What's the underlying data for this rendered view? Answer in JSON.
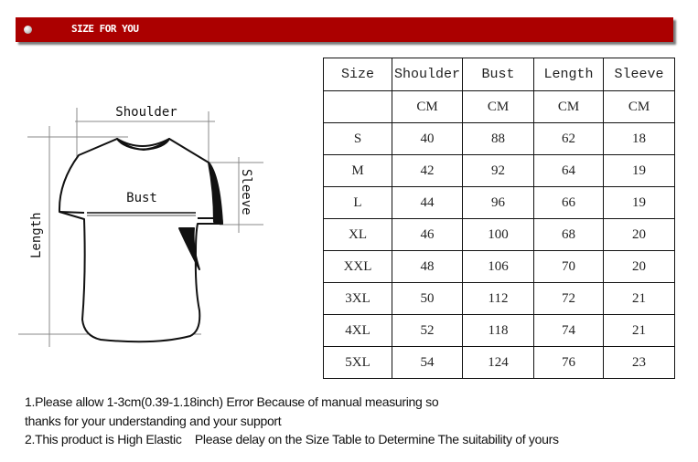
{
  "banner": {
    "title": "SIZE FOR YOU"
  },
  "diagram": {
    "labels": {
      "shoulder": "Shoulder",
      "bust": "Bust",
      "sleeve": "Sleeve",
      "length": "Length"
    }
  },
  "table": {
    "headers": [
      "Size",
      "Shoulder",
      "Bust",
      "Length",
      "Sleeve"
    ],
    "units": [
      "",
      "CM",
      "CM",
      "CM",
      "CM"
    ],
    "rows": [
      [
        "S",
        "40",
        "88",
        "62",
        "18"
      ],
      [
        "M",
        "42",
        "92",
        "64",
        "19"
      ],
      [
        "L",
        "44",
        "96",
        "66",
        "19"
      ],
      [
        "XL",
        "46",
        "100",
        "68",
        "20"
      ],
      [
        "XXL",
        "48",
        "106",
        "70",
        "20"
      ],
      [
        "3XL",
        "50",
        "112",
        "72",
        "21"
      ],
      [
        "4XL",
        "52",
        "118",
        "74",
        "21"
      ],
      [
        "5XL",
        "54",
        "124",
        "76",
        "23"
      ]
    ]
  },
  "notes": [
    "1.Please allow 1-3cm(0.39-1.18inch) Error Because of manual measuring so",
    "thanks for your understanding and your support",
    "2.This product is High Elastic    Please delay on the Size Table to Determine The suitability of yours"
  ]
}
